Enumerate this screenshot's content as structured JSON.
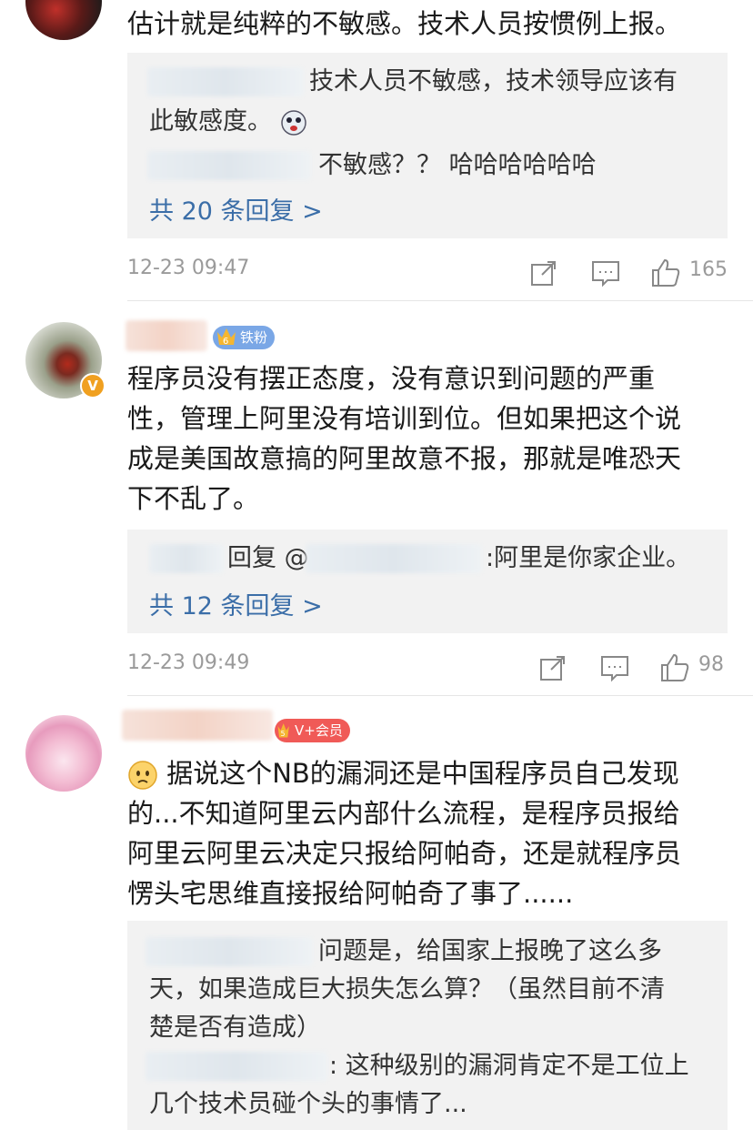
{
  "comments": [
    {
      "text": "估计就是纯粹的不敏感。技术人员按惯例上报。",
      "replies": [
        {
          "text_line1": "技术人员不敏感，技术领导应该有",
          "text_line2": "此敏感度。"
        },
        {
          "text": "不敏感？？ 哈哈哈哈哈哈"
        }
      ],
      "more_replies": "共 20 条回复 >",
      "time": "12-23 09:47",
      "likes": "165"
    },
    {
      "badge": "铁粉",
      "verified_mark": "V",
      "text_lines": [
        "程序员没有摆正态度，没有意识到问题的严重",
        "性，管理上阿里没有培训到位。但如果把这个说",
        "成是美国故意搞的阿里故意不报，那就是唯恐天",
        "下不乱了。"
      ],
      "reply_prefix": "回复 @",
      "reply_suffix": ":阿里是你家企业。",
      "more_replies": "共 12 条回复 >",
      "time": "12-23 09:49",
      "likes": "98"
    },
    {
      "badge": "V+会员",
      "text_lines": [
        "据说这个NB的漏洞还是中国程序员自己发现",
        "的...不知道阿里云内部什么流程，是程序员报给",
        "阿里云阿里云决定只报给阿帕奇，还是就程序员",
        "愣头宅思维直接报给阿帕奇了事了......"
      ],
      "replies": [
        {
          "lines": [
            "问题是，给国家上报晚了这么多",
            "天，如果造成巨大损失怎么算？（虽然目前不清",
            "楚是否有造成）"
          ]
        },
        {
          "lines": [
            ": 这种级别的漏洞肯定不是工位上",
            "几个技术员碰个头的事情了..."
          ]
        }
      ]
    }
  ],
  "icons": [
    "share-icon",
    "comment-icon",
    "like-icon"
  ],
  "colors": {
    "link": "#3b6ea8",
    "meta": "#9a9a9a",
    "reply_bg": "#f2f2f2",
    "badge_tiefen": "#7aa7e6",
    "badge_vip": "#f05a57"
  }
}
